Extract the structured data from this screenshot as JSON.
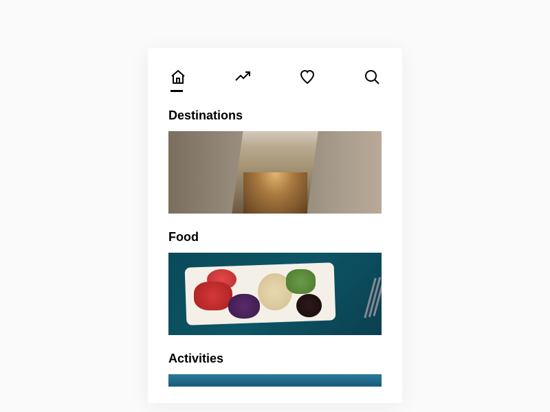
{
  "nav": {
    "items": [
      {
        "name": "home-icon",
        "active": true
      },
      {
        "name": "trending-icon",
        "active": false
      },
      {
        "name": "favorites-icon",
        "active": false
      },
      {
        "name": "search-icon",
        "active": false
      }
    ]
  },
  "sections": [
    {
      "title": "Destinations",
      "image": "destinations"
    },
    {
      "title": "Food",
      "image": "food"
    },
    {
      "title": "Activities",
      "image": "activities"
    }
  ]
}
